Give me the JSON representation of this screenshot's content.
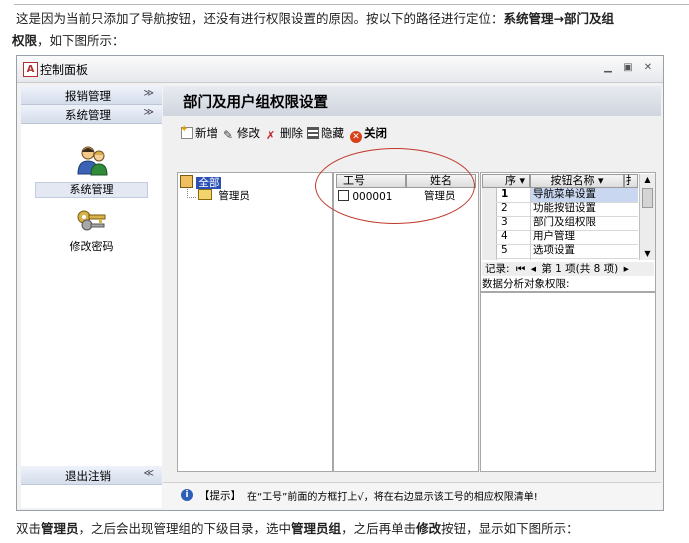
{
  "doc": {
    "intro_text": "这是因为当前只添加了导航按钮，还没有进行权限设置的原因。按以下的路径进行定位：",
    "intro_bold": "系统管理→部门及组",
    "line2_bold": "权限",
    "line2_text": "，如下图所示：",
    "outro_1": "双击",
    "outro_b1": "管理员",
    "outro_2": "，之后会出现管理组的下级目录，选中",
    "outro_b2": "管理员组",
    "outro_3": "，之后再单击",
    "outro_b3": "修改",
    "outro_4": "按钮，显示如下图所示："
  },
  "window": {
    "icon_letter": "A",
    "title": "控制面板"
  },
  "sidebar": {
    "section_reimburse": "报销管理",
    "section_system": "系统管理",
    "item_system": "系统管理",
    "item_password": "修改密码",
    "logout": "退出注销",
    "chev_down": "≫",
    "chev_up": "≪"
  },
  "main": {
    "title": "部门及用户组权限设置",
    "toolbar": {
      "add": "新增",
      "edit": "修改",
      "delete": "删除",
      "hide": "隐藏",
      "close": "关闭"
    },
    "tree": {
      "root": "全部",
      "child": "管理员"
    },
    "users": {
      "col_id": "工号",
      "col_name": "姓名",
      "rows": [
        {
          "id": "000001",
          "name": "管理员"
        }
      ]
    },
    "buttons": {
      "col_seq": "序",
      "col_name": "按钮名称",
      "col_extra": "扌",
      "rows": [
        {
          "seq": "1",
          "name": "导航菜单设置"
        },
        {
          "seq": "2",
          "name": "功能按钮设置"
        },
        {
          "seq": "3",
          "name": "部门及组权限"
        },
        {
          "seq": "4",
          "name": "用户管理"
        },
        {
          "seq": "5",
          "name": "选项设置"
        }
      ],
      "record_label": "记录:",
      "record_text": "第 1 项(共 8 项)"
    },
    "analysis_label": "数据分析对象权限:",
    "hint_tag": "【提示】",
    "hint_text": "在“工号”前面的方框打上√，将在右边显示该工号的相应权限清单!"
  },
  "colors": {
    "accent_red": "#c0392b",
    "selected_blue": "#2b4fb5"
  }
}
